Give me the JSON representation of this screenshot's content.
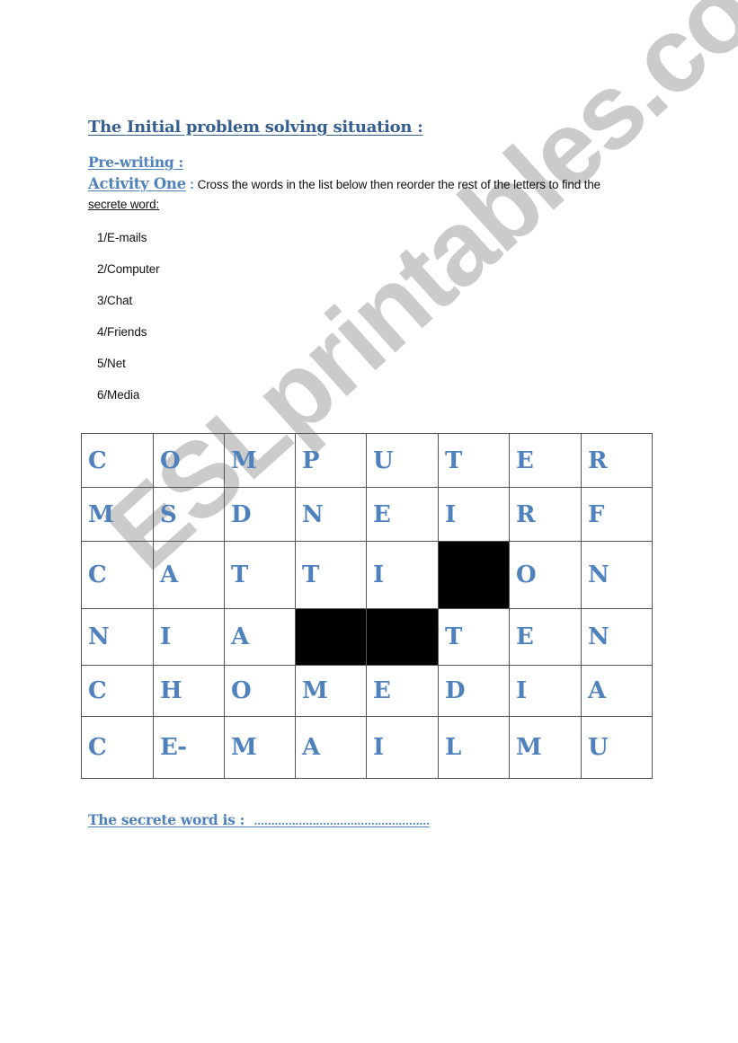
{
  "document": {
    "title": "The Initial problem solving situation :",
    "section": "Pre-writing :",
    "activity": {
      "label": "Activity One",
      "colon": " :",
      "instruction": " Cross the words in the list below then reorder the rest of the letters to find the",
      "instruction_continued": "secrete word:"
    },
    "word_list": [
      "1/E-mails",
      "2/Computer",
      "3/Chat",
      "4/Friends",
      "5/Net",
      "6/Media"
    ],
    "grid": {
      "rows": [
        [
          "C",
          "O",
          "M",
          "P",
          "U",
          "T",
          "E",
          "R"
        ],
        [
          "M",
          "S",
          "D",
          "N",
          "E",
          "I",
          "R",
          "F"
        ],
        [
          "C",
          "A",
          "T",
          "T",
          "I",
          "#",
          "O",
          "N"
        ],
        [
          "N",
          "I",
          "A",
          "#",
          "#",
          "T",
          "E",
          "N"
        ],
        [
          "C",
          "H",
          "O",
          "M",
          "E",
          "D",
          "I",
          "A"
        ],
        [
          "C",
          "E-",
          "M",
          "A",
          "I",
          "L",
          "M",
          "U"
        ]
      ],
      "blocked_marker": "#",
      "letter_color": "#4f81bd"
    },
    "answer": {
      "label": "The secrete word is :",
      "blank": "……………………………………………"
    },
    "watermark": "ESLprintables.com"
  },
  "colors": {
    "title": "#365f91",
    "heading": "#4f81bd",
    "body_text": "#111111",
    "blocked_cell": "#000000"
  }
}
